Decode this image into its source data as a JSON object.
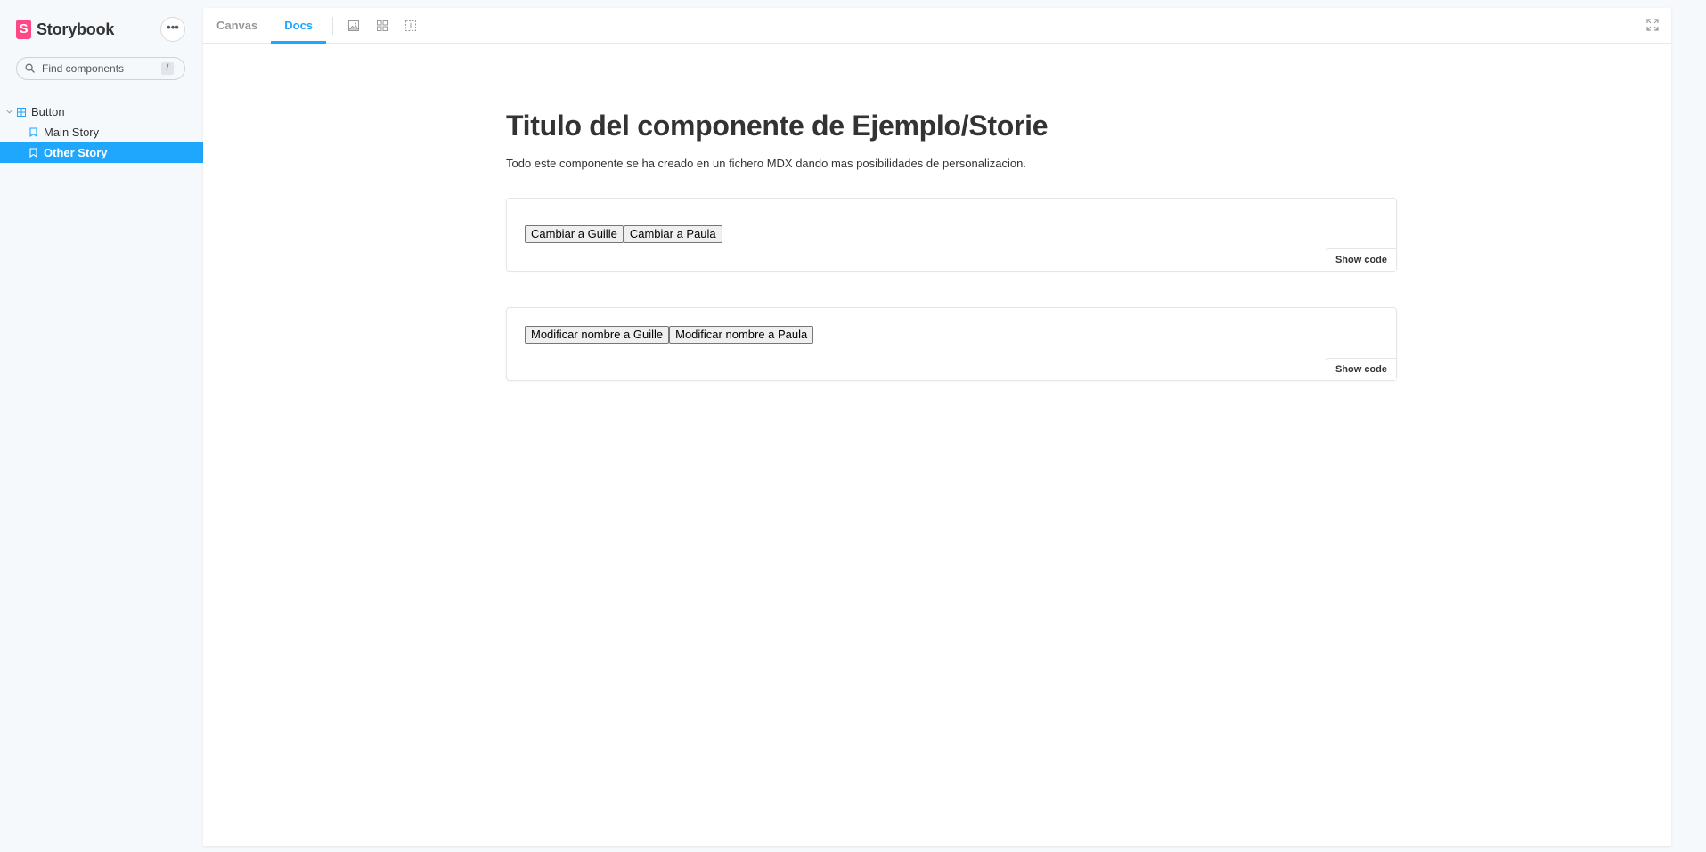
{
  "sidebar": {
    "brand": {
      "logo_letter": "S",
      "name": "Storybook"
    },
    "menu_label": "•••",
    "search": {
      "placeholder": "Find components",
      "shortcut": "/"
    },
    "tree": {
      "group_label": "Button",
      "stories": [
        {
          "label": "Main Story",
          "active": false
        },
        {
          "label": "Other Story",
          "active": true
        }
      ]
    }
  },
  "toolbar": {
    "tabs": [
      {
        "label": "Canvas",
        "active": false
      },
      {
        "label": "Docs",
        "active": true
      }
    ],
    "icons": [
      "image-icon",
      "grid-icon",
      "outline-icon"
    ],
    "expand_icon": "expand-icon"
  },
  "docs": {
    "title": "Titulo del componente de Ejemplo/Storie",
    "description": "Todo este componente se ha creado en un fichero MDX dando mas posibilidades de personalizacion.",
    "previews": [
      {
        "buttons": [
          "Cambiar a Guille",
          "Cambiar a Paula"
        ],
        "show_code": "Show code"
      },
      {
        "buttons": [
          "Modificar nombre a Guille",
          "Modificar nombre a Paula"
        ],
        "show_code": "Show code"
      }
    ]
  },
  "colors": {
    "accent": "#1ea7fd",
    "brand": "#ff4785",
    "sidebar_bg": "#f6f9fc"
  }
}
